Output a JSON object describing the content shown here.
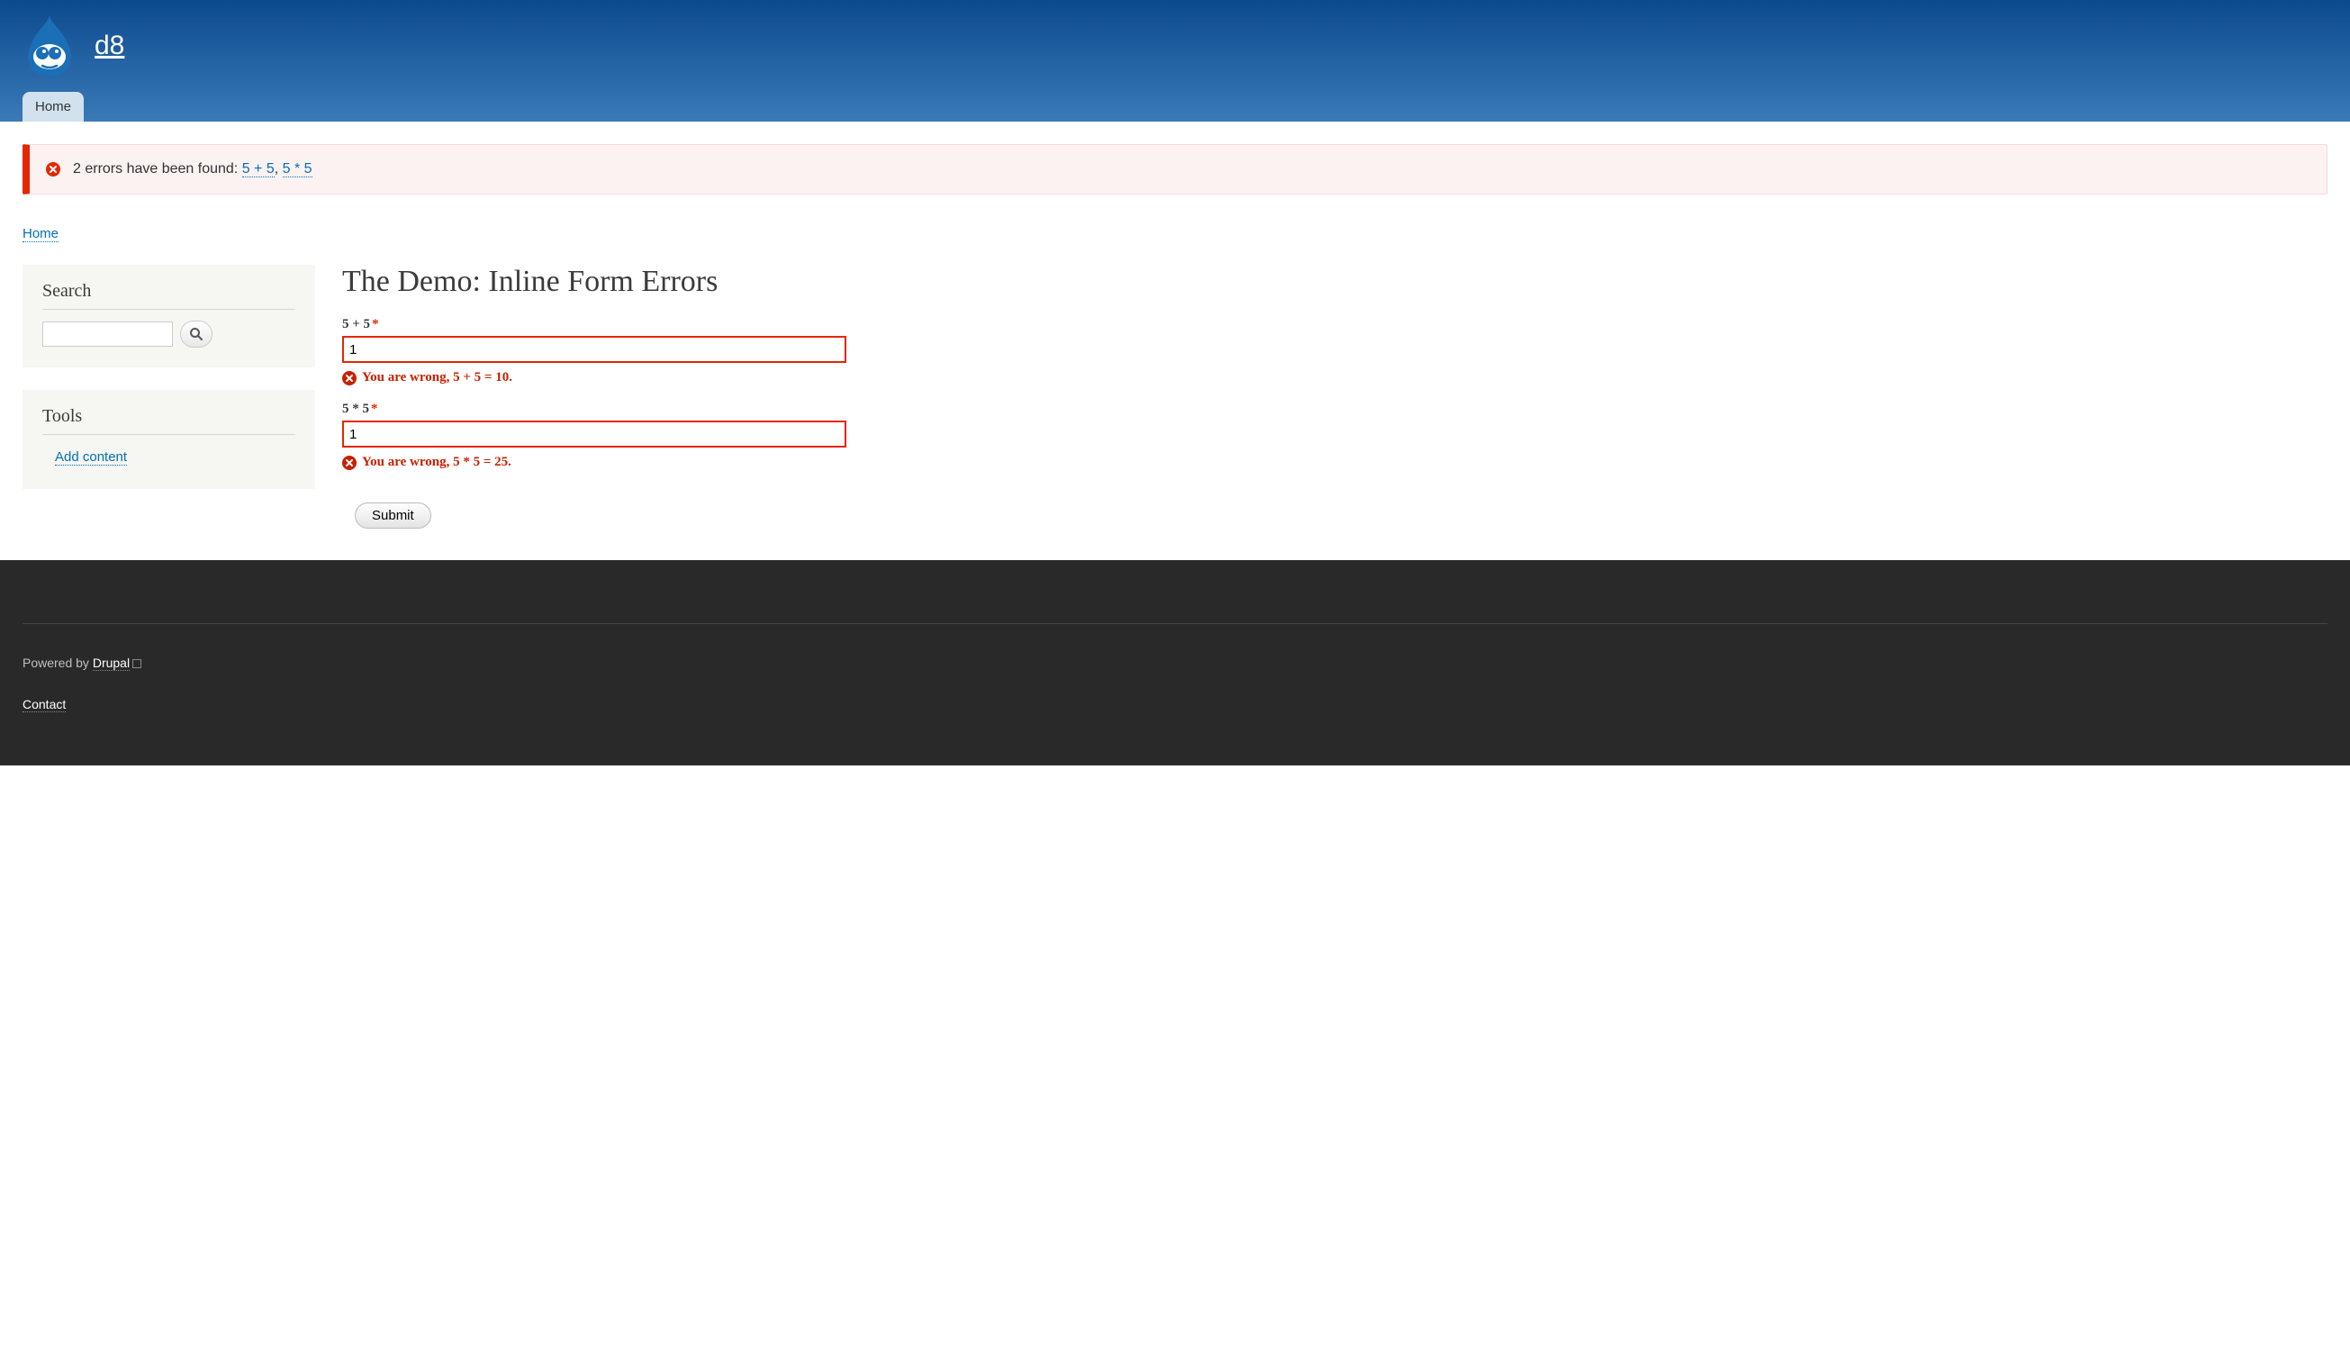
{
  "site": {
    "name": "d8"
  },
  "nav": {
    "home": "Home"
  },
  "messages": {
    "prefix": "2 errors have been found:",
    "link1": "5 + 5",
    "sep": ", ",
    "link2": "5 * 5"
  },
  "breadcrumb": {
    "home": "Home"
  },
  "sidebar": {
    "search": {
      "title": "Search",
      "value": ""
    },
    "tools": {
      "title": "Tools",
      "add_content": "Add content"
    }
  },
  "page": {
    "title": "The Demo: Inline Form Errors"
  },
  "form": {
    "field1": {
      "label": "5 + 5",
      "value": "1",
      "error": "You are wrong, 5 + 5 = 10."
    },
    "field2": {
      "label": "5 * 5",
      "value": "1",
      "error": "You are wrong, 5 * 5 = 25."
    },
    "submit": "Submit"
  },
  "footer": {
    "powered_prefix": "Powered by ",
    "powered_link": "Drupal",
    "contact": "Contact"
  }
}
